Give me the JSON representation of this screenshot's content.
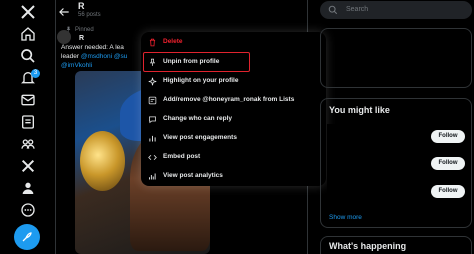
{
  "nav": {
    "notification_count": "3",
    "icons": [
      "x-logo-icon",
      "home-icon",
      "search-icon",
      "notifications-icon",
      "messages-icon",
      "lists-icon",
      "communities-icon",
      "premium-icon",
      "profile-icon",
      "more-icon"
    ]
  },
  "header": {
    "name": "R",
    "posts_count": "56 posts"
  },
  "post": {
    "pinned_label": "Pinned",
    "author": "R",
    "text_line1": "Answer needed: A lea",
    "text_line2_prefix": "leader ",
    "mention1": "@msdhoni",
    "mention2": "@su",
    "mention3": "@imVkohli"
  },
  "menu": {
    "delete": "Delete",
    "unpin": "Unpin from profile",
    "highlight": "Highlight on your profile",
    "lists": "Add/remove @honeyram_ronak from Lists",
    "reply": "Change who can reply",
    "engagements": "View post engagements",
    "embed": "Embed post",
    "analytics": "View post analytics"
  },
  "sidebar": {
    "search_placeholder": "Search",
    "you_might_like": "You might like",
    "follow": "Follow",
    "show_more": "Show more",
    "whats_happening": "What's happening"
  },
  "colors": {
    "accent": "#1d9bf0",
    "danger": "#f4212e",
    "highlight_border": "#e0232e"
  }
}
